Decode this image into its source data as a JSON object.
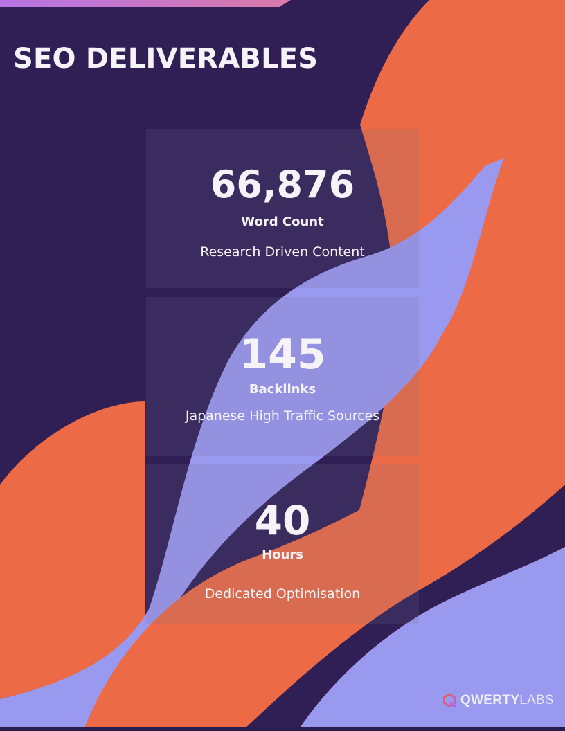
{
  "page": {
    "title": "SEO DELIVERABLES"
  },
  "colors": {
    "dark_purple": "#2f1f55",
    "orange": "#ec6a45",
    "lavender": "#9a99f0",
    "text": "#f6f3f8",
    "accent_gradient_start": "#b574e6",
    "accent_gradient_end": "#d97aa8"
  },
  "deliverables": [
    {
      "value": "66,876",
      "label": "Word Count",
      "description": "Research Driven Content"
    },
    {
      "value": "145",
      "label": "Backlinks",
      "description": "Japanese High Traffic Sources"
    },
    {
      "value": "40",
      "label": "Hours",
      "description": "Dedicated Optimisation"
    }
  ],
  "brand": {
    "icon": "qwertylabs-logo-icon",
    "name_strong": "QWERTY",
    "name_light": "LABS"
  }
}
